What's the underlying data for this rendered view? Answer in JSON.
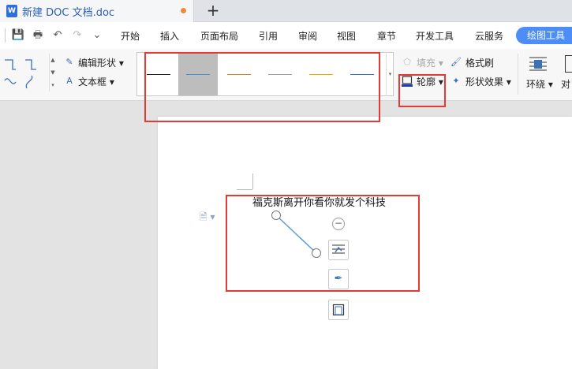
{
  "tab": {
    "title": "新建 DOC 文档.doc",
    "icon_letter": "W"
  },
  "quick_access": {
    "save": "💾",
    "print": "🖶",
    "undo": "↶",
    "redo": "↷",
    "more": "⌄"
  },
  "menu": {
    "items": [
      "开始",
      "插入",
      "页面布局",
      "引用",
      "审阅",
      "视图",
      "章节",
      "开发工具",
      "云服务"
    ],
    "active": "绘图工具"
  },
  "ribbon": {
    "edit_shape": "编辑形状",
    "textbox": "文本框",
    "fill": "填充",
    "format_painter": "格式刷",
    "outline": "轮廓",
    "shape_effect": "形状效果",
    "wrap": "环绕",
    "align": "对",
    "line_styles": [
      {
        "color": "#222222",
        "selected": false
      },
      {
        "color": "#4a8fd6",
        "selected": true
      },
      {
        "color": "#c8873a",
        "selected": false
      },
      {
        "color": "#9aa0a6",
        "selected": false
      },
      {
        "color": "#e0b200",
        "selected": false
      },
      {
        "color": "#3b6fb6",
        "selected": false
      }
    ]
  },
  "document": {
    "text": "福克斯离开你看你就发个科技",
    "float_buttons": [
      "layout-options",
      "pen",
      "outline"
    ]
  },
  "colors": {
    "accent": "#4c8ef5",
    "highlight": "#e53935",
    "line": "#5b9bd5"
  }
}
